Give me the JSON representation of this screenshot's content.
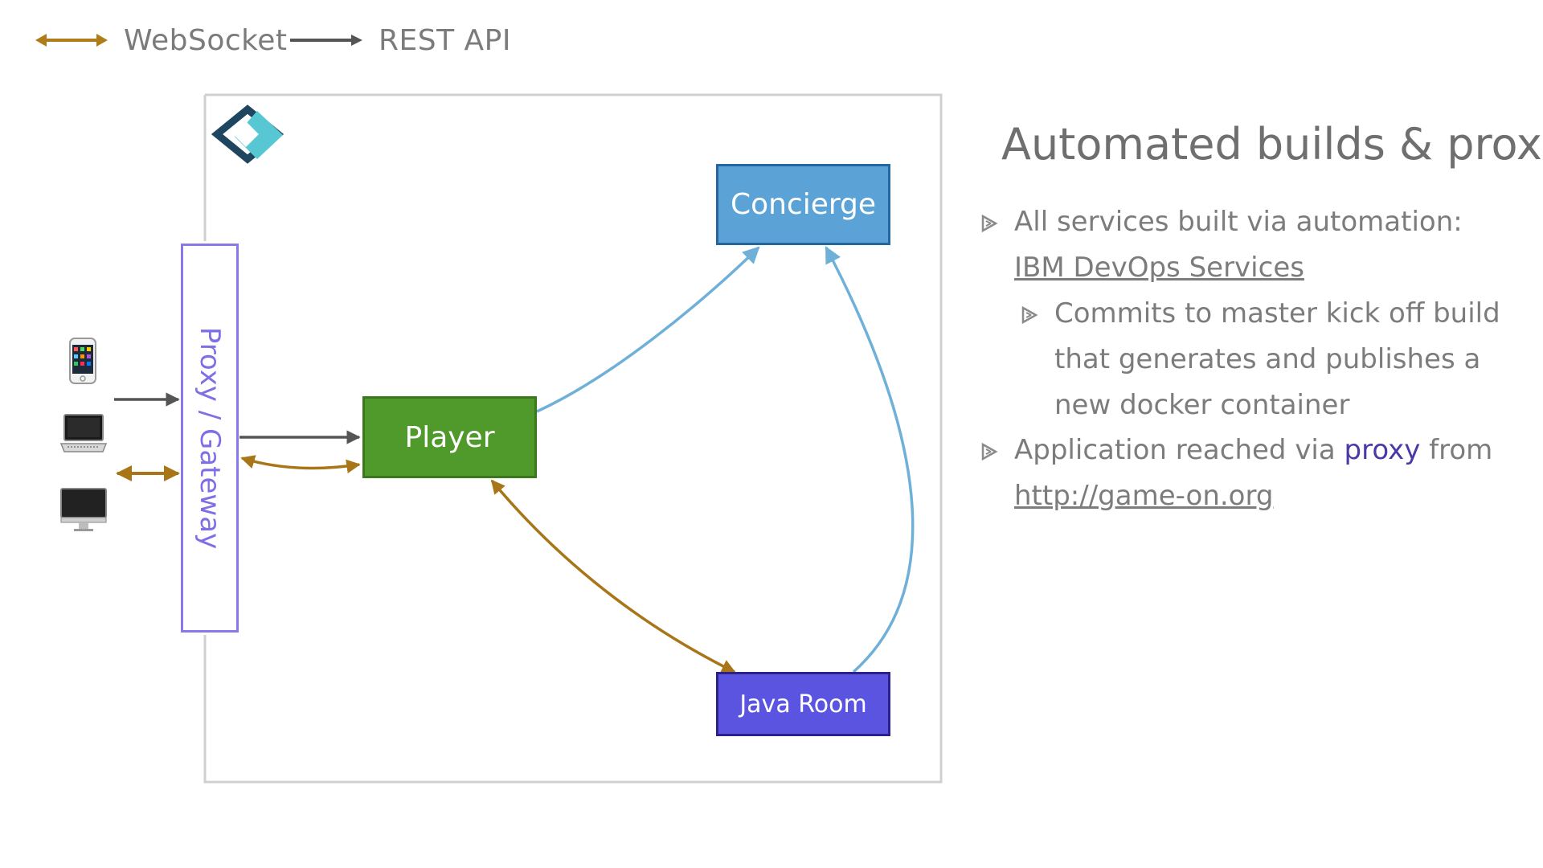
{
  "legend": {
    "websocket": {
      "label": "WebSocket",
      "color": "#b07c1a"
    },
    "rest": {
      "label": "REST API",
      "color": "#555555"
    }
  },
  "diagram": {
    "logo_icon": "game-on-logo",
    "proxy": {
      "label": "Proxy / Gateway",
      "color": "#8878ea"
    },
    "player": {
      "label": "Player",
      "color": "#4f9a2a"
    },
    "concierge": {
      "label": "Concierge",
      "color": "#5ba3d6"
    },
    "java_room": {
      "label": "Java Room",
      "color": "#5b54e0"
    },
    "clients": [
      "phone-icon",
      "laptop-icon",
      "desktop-icon"
    ]
  },
  "side": {
    "title": "Automated builds & proxy",
    "bullets": [
      {
        "text": "All services built via automation: ",
        "link": "IBM DevOps Services"
      },
      {
        "text": "Commits to master kick off build that generates and publishes a new docker container"
      },
      {
        "text": "Application reached via ",
        "accent": "proxy",
        "after": " from",
        "link": "http://game-on.org"
      }
    ]
  }
}
